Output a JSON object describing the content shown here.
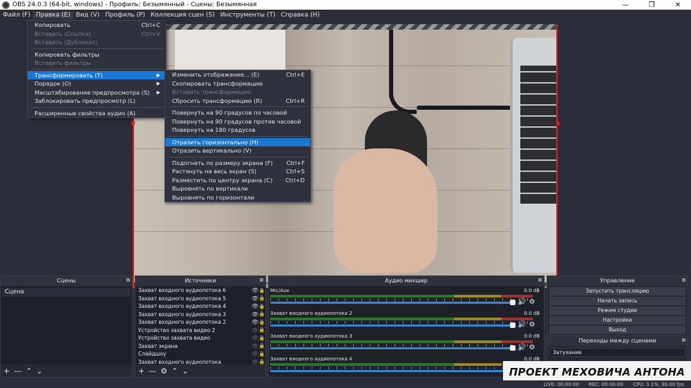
{
  "window": {
    "title": "OBS 24.0.3 (64-bit, windows) - Профиль: Безымянный - Сцены: Безымянная"
  },
  "menubar": [
    "Файл (F)",
    "Правка (E)",
    "Вид (V)",
    "Профиль (P)",
    "Коллекция сцен (S)",
    "Инструменты (T)",
    "Справка (H)"
  ],
  "edit_menu": [
    {
      "label": "Копировать",
      "shortcut": "Ctrl+C",
      "disabled": false
    },
    {
      "label": "Вставить (Ссылка)",
      "shortcut": "Ctrl+V",
      "disabled": true
    },
    {
      "label": "Вставить (Дубликат)",
      "shortcut": "",
      "disabled": true
    },
    {
      "sep": true
    },
    {
      "label": "Копировать фильтры",
      "shortcut": "",
      "disabled": false
    },
    {
      "label": "Вставить фильтры",
      "shortcut": "",
      "disabled": true
    },
    {
      "sep": true
    },
    {
      "label": "Трансформировать (T)",
      "shortcut": "",
      "submenu": true,
      "highlight": true
    },
    {
      "label": "Порядок (O)",
      "shortcut": "",
      "submenu": true
    },
    {
      "label": "Масштабирование предпросмотра (S)",
      "shortcut": "",
      "submenu": true
    },
    {
      "label": "Заблокировать предпросмотр (L)",
      "shortcut": ""
    },
    {
      "sep": true
    },
    {
      "label": "Расширенные свойства аудио (A)",
      "shortcut": ""
    }
  ],
  "transform_menu": [
    {
      "label": "Изменить отображение... (E)",
      "shortcut": "Ctrl+E"
    },
    {
      "label": "Скопировать трансформацию",
      "shortcut": ""
    },
    {
      "label": "Вставить трансформацию",
      "shortcut": "",
      "disabled": true
    },
    {
      "label": "Сбросить трансформацию (R)",
      "shortcut": "Ctrl+R"
    },
    {
      "sep": true
    },
    {
      "label": "Повернуть на 90 градусов по часовой",
      "shortcut": ""
    },
    {
      "label": "Повернуть на 90 градусов против часовой",
      "shortcut": ""
    },
    {
      "label": "Повернуть на 180 градусов",
      "shortcut": ""
    },
    {
      "sep": true
    },
    {
      "label": "Отразить горизонтально (H)",
      "shortcut": "",
      "highlight": true
    },
    {
      "label": "Отразить вертикально (V)",
      "shortcut": ""
    },
    {
      "sep": true
    },
    {
      "label": "Подогнать по размеру экрана (F)",
      "shortcut": "Ctrl+F"
    },
    {
      "label": "Растянуть на весь экран (S)",
      "shortcut": "Ctrl+S"
    },
    {
      "label": "Разместить по центру экрана (C)",
      "shortcut": "Ctrl+D"
    },
    {
      "label": "Выровнять по вертикали",
      "shortcut": ""
    },
    {
      "label": "Выровнять по горизонтали",
      "shortcut": ""
    }
  ],
  "docks": {
    "scenes": {
      "title": "Сцены",
      "items": [
        "Сцена"
      ]
    },
    "sources": {
      "title": "Источники",
      "items": [
        {
          "name": "Захват входного аудиопотока 6",
          "visible": true
        },
        {
          "name": "Захват входного аудиопотока 5",
          "visible": true
        },
        {
          "name": "Захват входного аудиопотока 4",
          "visible": true
        },
        {
          "name": "Захват входного аудиопотока 3",
          "visible": true
        },
        {
          "name": "Захват входного аудиопотока 2",
          "visible": true
        },
        {
          "name": "Устройство захвата видео 2",
          "visible": false
        },
        {
          "name": "Устройство захвата видео",
          "visible": false
        },
        {
          "name": "Захват экрана",
          "visible": false
        },
        {
          "name": "Слайдшоу",
          "visible": false
        },
        {
          "name": "Захват входного аудиопотока",
          "visible": false
        }
      ]
    },
    "mixer": {
      "title": "Аудио микшер",
      "channels": [
        {
          "name": "Mic/Aux",
          "level": "0.0 dB"
        },
        {
          "name": "Захват входного аудиопотока 2",
          "level": "0.0 dB"
        },
        {
          "name": "Захват входного аудиопотока 3",
          "level": "0.0 dB"
        },
        {
          "name": "Захват входного аудиопотока 4",
          "level": "0.0 dB"
        }
      ]
    },
    "controls": {
      "title": "Управление",
      "buttons": [
        "Запустить трансляцию",
        "Начать запись",
        "Режим студии",
        "Настройки",
        "Выход"
      ]
    },
    "transitions": {
      "title": "Переходы между сценами",
      "selected": "Затухание"
    }
  },
  "watermark": "ПРОЕКТ МЕХОВИЧА АНТОНА",
  "status": {
    "live": "LIVE: 00:00:00",
    "rec": "REC: 00:00:00",
    "cpu": "CPU: 3.1%, 30.00 fps"
  }
}
